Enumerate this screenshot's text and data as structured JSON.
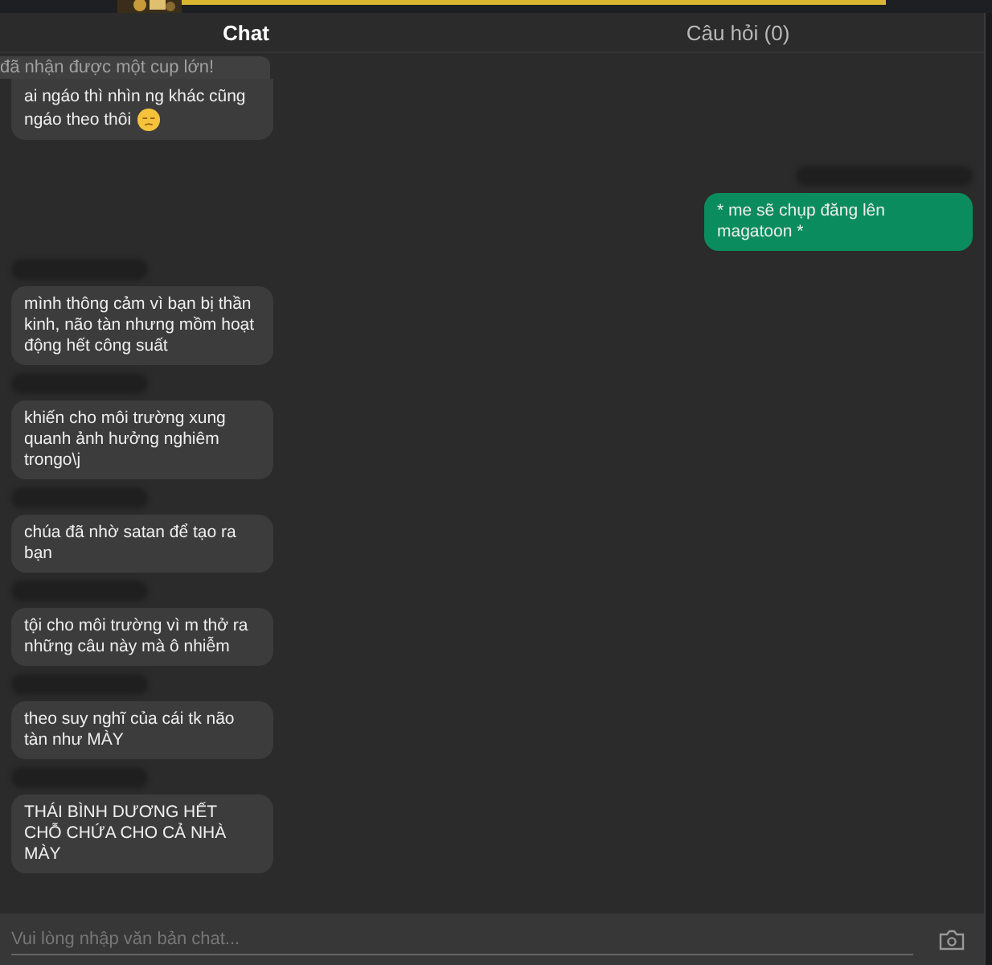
{
  "tabs": [
    {
      "label": "Chat",
      "selected": true
    },
    {
      "label": "Câu hỏi (0)",
      "selected": false
    }
  ],
  "toast": {
    "text": "đã nhận được một cup lớn!"
  },
  "messages": [
    {
      "kind": "incoming",
      "redacted_author": false,
      "text": "ai ngáo thì nhìn ng khác cũng ngáo theo thôi",
      "emoji": true
    },
    {
      "kind": "outgoing",
      "redacted_author": true,
      "text": "* me sẽ chụp đăng lên magatoon *",
      "emoji": false
    },
    {
      "kind": "incoming",
      "redacted_author": true,
      "text": "mình thông cảm vì bạn bị thần kinh, não tàn nhưng mồm hoạt động hết công suất",
      "emoji": false
    },
    {
      "kind": "incoming",
      "redacted_author": true,
      "text": "khiến cho môi trường xung quanh ảnh hưởng nghiêm trongo\\j",
      "emoji": false
    },
    {
      "kind": "incoming",
      "redacted_author": true,
      "text": "chúa đã nhờ satan để tạo ra bạn",
      "emoji": false
    },
    {
      "kind": "incoming",
      "redacted_author": true,
      "text": "tội cho môi trường vì m thở ra những câu này mà ô nhiễm",
      "emoji": false
    },
    {
      "kind": "incoming",
      "redacted_author": true,
      "text": "theo suy nghĩ của cái tk não tàn như MÀY",
      "emoji": false
    },
    {
      "kind": "incoming",
      "redacted_author": true,
      "text": "THÁI BÌNH DƯƠNG HẾT CHỖ CHỨA CHO CẢ NHÀ MÀY",
      "emoji": false
    }
  ],
  "input": {
    "placeholder": "Vui lòng nhập văn bản chat..."
  }
}
